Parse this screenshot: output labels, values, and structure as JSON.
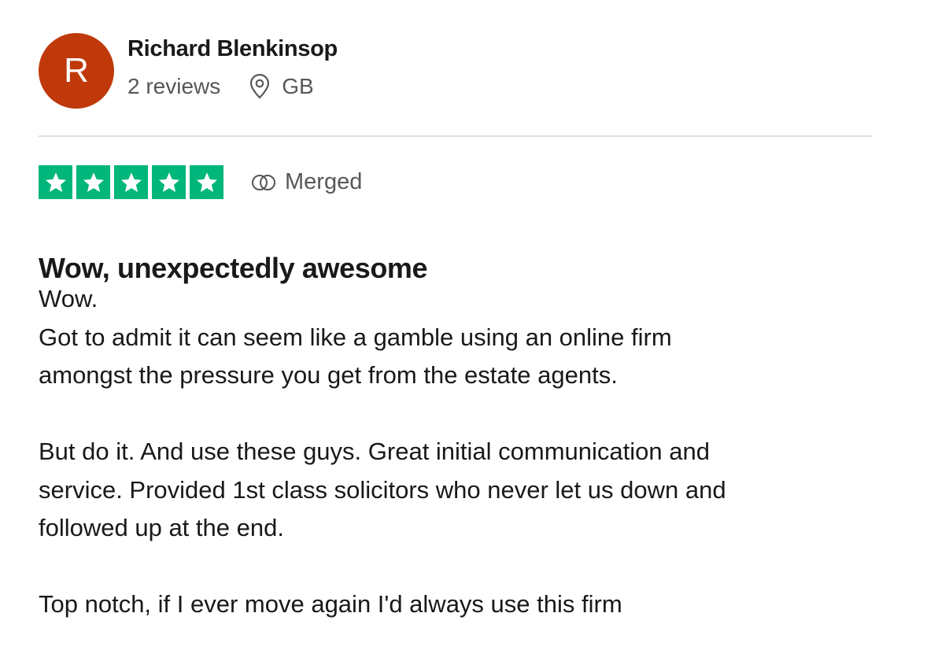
{
  "consumer": {
    "initial": "R",
    "name": "Richard Blenkinsop",
    "reviews": "2 reviews",
    "country": "GB",
    "avatar_color": "#c0390b"
  },
  "rating": {
    "stars": 5,
    "max_stars": 5,
    "star_color": "#00b67a",
    "merged_label": "Merged"
  },
  "review": {
    "title": "Wow, unexpectedly awesome",
    "paragraphs": [
      [
        "Wow.",
        "Got to admit it can seem like a gamble using an online firm",
        "amongst the pressure you get from the estate agents."
      ],
      [
        "But do it. And use these guys. Great initial communication and",
        "service. Provided 1st class solicitors who never let us down and",
        "followed up at the end."
      ],
      [
        "Top notch, if I ever move again I'd always use this firm"
      ]
    ]
  },
  "icons": {
    "location": "location-pin-icon",
    "merged": "merged-rings-icon",
    "star": "star-icon"
  }
}
